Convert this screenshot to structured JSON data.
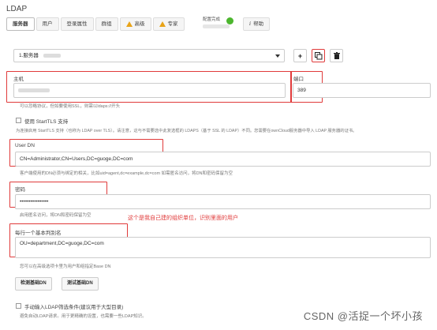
{
  "title": "LDAP",
  "tabs": [
    {
      "label": "服务器",
      "active": true,
      "warn": false
    },
    {
      "label": "用户",
      "active": false,
      "warn": false
    },
    {
      "label": "登录属性",
      "active": false,
      "warn": false
    },
    {
      "label": "群组",
      "active": false,
      "warn": false
    },
    {
      "label": "高级",
      "active": false,
      "warn": true
    },
    {
      "label": "专家",
      "active": false,
      "warn": true
    }
  ],
  "status_text": "配置完成",
  "status_color": "#4cb62e",
  "help_tab": "帮助",
  "server_select": "1.服务器",
  "host": {
    "label": "主机",
    "hint": "可以忽略协议，但如要使用SSL，则需以ldaps://开头"
  },
  "port": {
    "label": "端口",
    "value": "389"
  },
  "starttls": {
    "label": "使用 StartTLS 支持",
    "hint": "为连接启用 StartTLS 支持（也称为 LDAP over TLS）。请注意，这与不需要选中此复选框的 LDAPS（基于 SSL 的 LDAP）不同。您需要在ownCloud服务器中导入 LDAP 服务器的证书。"
  },
  "userdn": {
    "label": "User DN",
    "value": "CN=Administrator,CN=Users,DC=guoge,DC=com",
    "hint": "客户端使用的DN必须与绑定的相关，比如uid=agent,dc=example,dc=com 如需匿名访问，将DN和密码保留为空"
  },
  "password": {
    "label": "密码",
    "value": "••••••••••••••••",
    "hint": "启用匿名访问，将DN和密码保留为空"
  },
  "annotation": "这个是我自己建的组织单位，识别里面的用户",
  "basedn": {
    "label": "每行一个基本判别名",
    "value": "OU=department,DC=guoge,DC=com",
    "hint": "您可以在高级选项卡里为用户和组指定Base DN"
  },
  "buttons": {
    "detect": "检测基础DN",
    "test": "测试基础DN"
  },
  "manual_filter": {
    "label": "手动输入LDAP筛选条件(建议用于大型目录)",
    "hint": "避免自动LDAP请求。用于更精确的设置，也需要一些LDAP知识。"
  },
  "watermark": "CSDN @活捉一个坏小孩",
  "icons": {
    "add": "plus-icon",
    "copy": "copy-icon",
    "delete": "trash-icon",
    "help": "info-icon"
  }
}
